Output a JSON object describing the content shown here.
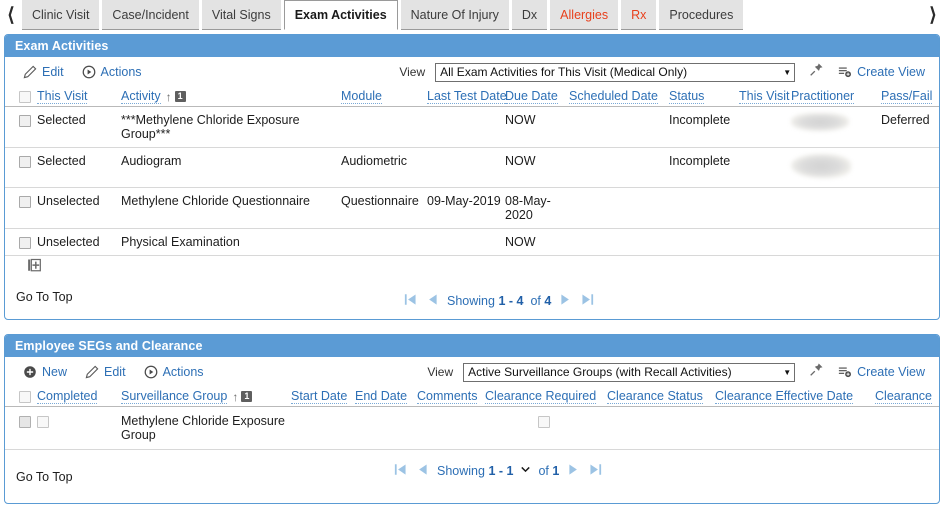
{
  "tabbar": {
    "prev_icon": "chevron-left-icon",
    "next_icon": "chevron-right-icon",
    "tabs": [
      {
        "label": "Clinic Visit",
        "active": false,
        "alert": false
      },
      {
        "label": "Case/Incident",
        "active": false,
        "alert": false
      },
      {
        "label": "Vital Signs",
        "active": false,
        "alert": false
      },
      {
        "label": "Exam Activities",
        "active": true,
        "alert": false
      },
      {
        "label": "Nature Of Injury",
        "active": false,
        "alert": false
      },
      {
        "label": "Dx",
        "active": false,
        "alert": false
      },
      {
        "label": "Allergies",
        "active": false,
        "alert": true
      },
      {
        "label": "Rx",
        "active": false,
        "alert": true
      },
      {
        "label": "Procedures",
        "active": false,
        "alert": false
      }
    ]
  },
  "colors": {
    "panel_header_bg": "#5b9bd5",
    "panel_border": "#5a9bd4",
    "link": "#2d6fb5",
    "alert_text": "#e8401c",
    "now_text": "#d42a2a",
    "tab_inactive_bg": "#e3e3e3"
  },
  "exam_panel": {
    "title": "Exam Activities",
    "toolbar": {
      "edit_label": "Edit",
      "edit_icon": "pencil-icon",
      "actions_label": "Actions",
      "actions_icon": "play-circle-icon",
      "view_label": "View",
      "view_value": "All Exam Activities for This Visit (Medical Only)",
      "pin_icon": "pin-icon",
      "create_view_label": "Create View",
      "create_view_icon": "list-add-icon"
    },
    "columns": [
      {
        "label": "This Visit",
        "sortable": true,
        "sort": null
      },
      {
        "label": "Activity",
        "sortable": true,
        "sort": {
          "direction": "asc",
          "order": "1"
        }
      },
      {
        "label": "Module",
        "sortable": true,
        "sort": null
      },
      {
        "label": "Last Test Date",
        "sortable": true,
        "sort": null
      },
      {
        "label": "Due Date",
        "sortable": true,
        "sort": null
      },
      {
        "label": "Scheduled Date",
        "sortable": true,
        "sort": null
      },
      {
        "label": "Status",
        "sortable": true,
        "sort": null
      },
      {
        "label": "This Visit",
        "sortable": true,
        "sort": null
      },
      {
        "label": "Practitioner",
        "sortable": true,
        "sort": null
      },
      {
        "label": "Pass/Fail",
        "sortable": true,
        "sort": null
      }
    ],
    "rows": [
      {
        "checked": false,
        "this_visit": "Selected",
        "activity": "***Methylene Chloride Exposure Group***",
        "module": "",
        "last_test_date": "",
        "due_date": "NOW",
        "due_date_is_now": true,
        "scheduled_date": "",
        "status": "Incomplete",
        "this_visit_2": "",
        "practitioner": "",
        "practitioner_redacted": true,
        "pass_fail": "Deferred"
      },
      {
        "checked": false,
        "this_visit": "Selected",
        "activity": "Audiogram",
        "module": "Audiometric",
        "last_test_date": "",
        "due_date": "NOW",
        "due_date_is_now": true,
        "scheduled_date": "",
        "status": "Incomplete",
        "this_visit_2": "",
        "practitioner": "",
        "practitioner_redacted": true,
        "pass_fail": ""
      },
      {
        "checked": false,
        "this_visit": "Unselected",
        "activity": "Methylene Chloride Questionnaire",
        "module": "Questionnaire",
        "last_test_date": "09-May-2019",
        "due_date": "08-May-2020",
        "due_date_is_now": false,
        "scheduled_date": "",
        "status": "",
        "this_visit_2": "",
        "practitioner": "",
        "practitioner_redacted": false,
        "pass_fail": ""
      },
      {
        "checked": false,
        "this_visit": "Unselected",
        "activity": "Physical Examination",
        "module": "",
        "last_test_date": "",
        "due_date": "NOW",
        "due_date_is_now": true,
        "scheduled_date": "",
        "status": "",
        "this_visit_2": "",
        "practitioner": "",
        "practitioner_redacted": false,
        "pass_fail": ""
      }
    ],
    "footer": {
      "add_row_icon": "grid-add-icon",
      "go_to_top": "Go To Top",
      "pager": {
        "first_icon": "first-page-icon",
        "prev_icon": "prev-page-icon",
        "next_icon": "next-page-icon",
        "last_icon": "last-page-icon",
        "showing_word": "Showing",
        "range": "1 - 4",
        "of_word": "of",
        "total": "4",
        "has_caret": false
      }
    }
  },
  "segs_panel": {
    "title": "Employee SEGs and Clearance",
    "toolbar": {
      "new_label": "New",
      "new_icon": "plus-circle-icon",
      "edit_label": "Edit",
      "edit_icon": "pencil-icon",
      "actions_label": "Actions",
      "actions_icon": "play-circle-icon",
      "view_label": "View",
      "view_value": "Active Surveillance Groups (with Recall Activities)",
      "pin_icon": "pin-icon",
      "create_view_label": "Create View",
      "create_view_icon": "list-add-icon"
    },
    "columns": [
      {
        "label": "Completed",
        "sortable": true,
        "sort": null
      },
      {
        "label": "Surveillance Group",
        "sortable": true,
        "sort": {
          "direction": "asc",
          "order": "1"
        }
      },
      {
        "label": "Start Date",
        "sortable": true,
        "sort": null
      },
      {
        "label": "End Date",
        "sortable": true,
        "sort": null
      },
      {
        "label": "Comments",
        "sortable": true,
        "sort": null
      },
      {
        "label": "Clearance Required",
        "sortable": true,
        "sort": null
      },
      {
        "label": "Clearance Status",
        "sortable": true,
        "sort": null
      },
      {
        "label": "Clearance Effective Date",
        "sortable": true,
        "sort": null
      },
      {
        "label": "Clearance",
        "sortable": true,
        "sort": null
      }
    ],
    "rows": [
      {
        "row_checked": false,
        "completed": false,
        "surveillance_group": "Methylene Chloride Exposure Group",
        "start_date": "",
        "end_date": "",
        "comments": "",
        "clearance_required": false,
        "clearance_status": "",
        "clearance_effective_date": "",
        "clearance": ""
      }
    ],
    "footer": {
      "go_to_top": "Go To Top",
      "pager": {
        "first_icon": "first-page-icon",
        "prev_icon": "prev-page-icon",
        "next_icon": "next-page-icon",
        "last_icon": "last-page-icon",
        "showing_word": "Showing",
        "range": "1 - 1",
        "of_word": "of",
        "total": "1",
        "has_caret": true,
        "caret_icon": "chevron-down-icon"
      }
    }
  }
}
